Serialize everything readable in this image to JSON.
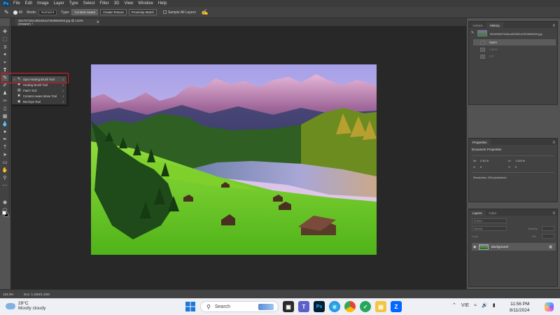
{
  "menubar": {
    "logo": "Ps",
    "items": [
      "File",
      "Edit",
      "Image",
      "Layer",
      "Type",
      "Select",
      "Filter",
      "3D",
      "View",
      "Window",
      "Help"
    ]
  },
  "options": {
    "brush_size": "40",
    "mode_label": "Mode:",
    "mode_value": "Normal",
    "type_label": "Type:",
    "type_buttons": [
      "Content-Aware",
      "Create Texture",
      "Proximity Match"
    ],
    "sample_all_layers": "Sample All Layers"
  },
  "document": {
    "tab_title": "45176720cc851681a7263984600.jpg @ 133% (RGB/8*) *"
  },
  "flyout": {
    "items": [
      {
        "label": "Spot Healing Brush Tool",
        "key": "J",
        "icon": "spot-healing-icon",
        "selected": true
      },
      {
        "label": "Healing Brush Tool",
        "key": "J",
        "icon": "healing-brush-icon",
        "selected": false
      },
      {
        "label": "Patch Tool",
        "key": "J",
        "icon": "patch-icon",
        "selected": false
      },
      {
        "label": "Content-Aware Move Tool",
        "key": "J",
        "icon": "content-aware-move-icon",
        "selected": false
      },
      {
        "label": "Red Eye Tool",
        "key": "J",
        "icon": "red-eye-icon",
        "selected": false
      }
    ]
  },
  "history_panel": {
    "tabs": [
      "Actions",
      "History"
    ],
    "active_tab": "History",
    "snapshot_name": "55c5045670c8cc851681a7263984600.jpg",
    "states": [
      {
        "label": "Open",
        "state": "active"
      },
      {
        "label": "Lasso",
        "state": "dim"
      },
      {
        "label": "Fill",
        "state": "dim"
      }
    ]
  },
  "properties_panel": {
    "title": "Properties",
    "subtitle": "Document Properties",
    "w_label": "W:",
    "w_value": "2.40 in",
    "h_label": "H:",
    "h_value": "1.620 in",
    "x_label": "X:",
    "x_value": "0",
    "y_label": "Y:",
    "y_value": "0",
    "resolution": "Resolution: 300 pixels/inch"
  },
  "layers_panel": {
    "tabs": [
      "Layers",
      "Color"
    ],
    "active_tab": "Layers",
    "filter": "Kind",
    "blend": "Normal",
    "opacity": "Opacity:",
    "lock": "Lock:",
    "fill": "Fill:",
    "layers": [
      {
        "name": "Background"
      }
    ]
  },
  "statusbar": {
    "zoom": "133.3%",
    "doc": "Doc: 1.22M/1.22M"
  },
  "taskbar": {
    "weather_temp": "29°C",
    "weather_desc": "Mostly cloudy",
    "search_placeholder": "Search",
    "tray_lang": "VIE",
    "time": "11:56 PM",
    "date": "8/11/2024"
  },
  "colors": {
    "highlight": "#e51c23",
    "ps_blue": "#31a8ff"
  }
}
